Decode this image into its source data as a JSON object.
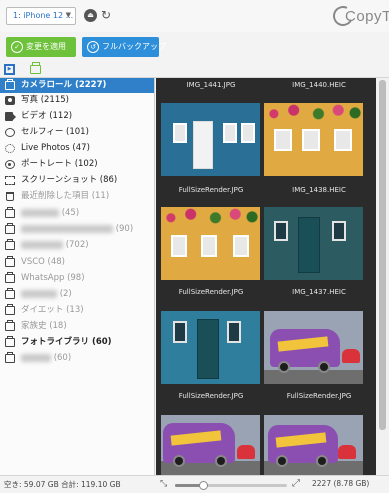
{
  "topbar": {
    "device": "1: iPhone 12 ...",
    "logo_text": "CopyTra"
  },
  "actions": {
    "apply": "変更を適用",
    "backup": "フルバックアップ"
  },
  "sidebar": {
    "items": [
      {
        "label": "カメラロール (2227)",
        "icon": "album-icon"
      },
      {
        "label": "写真 (2115)",
        "icon": "camera-icon"
      },
      {
        "label": "ビデオ (112)",
        "icon": "video-icon"
      },
      {
        "label": "セルフィー (101)",
        "icon": "selfie-icon"
      },
      {
        "label": "Live Photos (47)",
        "icon": "live-photo-icon"
      },
      {
        "label": "ポートレート (102)",
        "icon": "portrait-icon"
      },
      {
        "label": "スクリーンショット (86)",
        "icon": "screenshot-icon"
      },
      {
        "label": "最近削除した項目 (11)",
        "icon": "trash-icon"
      },
      {
        "label": "(45)",
        "icon": "album-icon"
      },
      {
        "label": "(90)",
        "icon": "album-icon"
      },
      {
        "label": "(702)",
        "icon": "album-icon"
      },
      {
        "label": "VSCO (48)",
        "icon": "album-icon"
      },
      {
        "label": "WhatsApp (98)",
        "icon": "album-icon"
      },
      {
        "label": "(2)",
        "icon": "album-icon"
      },
      {
        "label": "ダイエット (13)",
        "icon": "album-icon"
      },
      {
        "label": "家族史 (18)",
        "icon": "album-icon"
      },
      {
        "label": "フォトライブラリ (60)",
        "icon": "album-icon"
      },
      {
        "label": "(60)",
        "icon": "album-icon"
      }
    ]
  },
  "grid": {
    "rows": [
      {
        "left": "IMG_1441.JPG",
        "right": "IMG_1440.HEIC"
      },
      {
        "left": "FullSizeRender.JPG",
        "right": "IMG_1438.HEIC"
      },
      {
        "left": "FullSizeRender.JPG",
        "right": "IMG_1437.HEIC"
      },
      {
        "left": "FullSizeRender.JPG",
        "right": "FullSizeRender.JPG"
      }
    ]
  },
  "status": {
    "storage": "空き: 59.07 GB 合計: 119.10 GB",
    "count": "2227 (8.78 GB)",
    "zoom_level": 0.25
  },
  "colors": {
    "accent_blue": "#2f80c8",
    "apply_green": "#6ec13b",
    "backup_blue": "#2d8fd9",
    "grid_bg": "#2b2b2b"
  }
}
